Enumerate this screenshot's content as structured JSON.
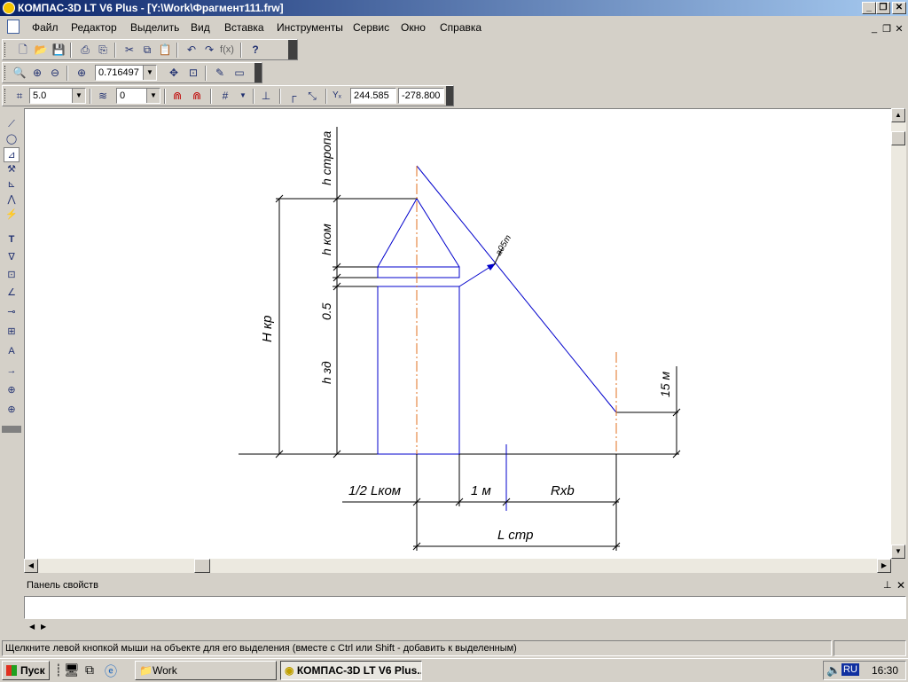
{
  "window": {
    "title": "КОМПАС-3D LT V6 Plus - [Y:\\Work\\Фрагмент111.frw]",
    "minimize_icon": "minimize-icon",
    "restore_icon": "restore-icon",
    "close_icon": "close-icon"
  },
  "menu": {
    "items": [
      "Файл",
      "Редактор",
      "Выделить",
      "Вид",
      "Вставка",
      "Инструменты",
      "Сервис",
      "Окно",
      "Справка"
    ]
  },
  "toolbar_view": {
    "zoom_value": "0.716497"
  },
  "toolbar_props": {
    "step_value": "5.0",
    "layer_value": "0",
    "coord_x": "244.585",
    "coord_y": "-278.800",
    "coord_label": "Yₓ"
  },
  "drawing": {
    "labels": {
      "h_strop": "h стропа",
      "h_kom": "h ком",
      "h_05": "0.5",
      "h_zd": "h зд",
      "H_kr": "H кр",
      "m15": "15 м",
      "a05": "a05m",
      "half_l": "1/2 Lком",
      "one_m": "1 м",
      "rxb": "Rxb",
      "l_str": "L стр"
    },
    "colors": {
      "line_black": "#000000",
      "line_blue": "#0000cc",
      "axis_orange": "#e07020"
    }
  },
  "properties_panel": {
    "title": "Панель свойств"
  },
  "status": {
    "hint": "Щелкните левой кнопкой мыши на объекте для его выделения (вместе с Ctrl или Shift - добавить к выделенным)"
  },
  "taskbar": {
    "start_label": "Пуск",
    "tasks": [
      "Work",
      "КОМПАС-3D LT V6 Plus..."
    ],
    "lang": "RU",
    "clock": "16:30"
  }
}
